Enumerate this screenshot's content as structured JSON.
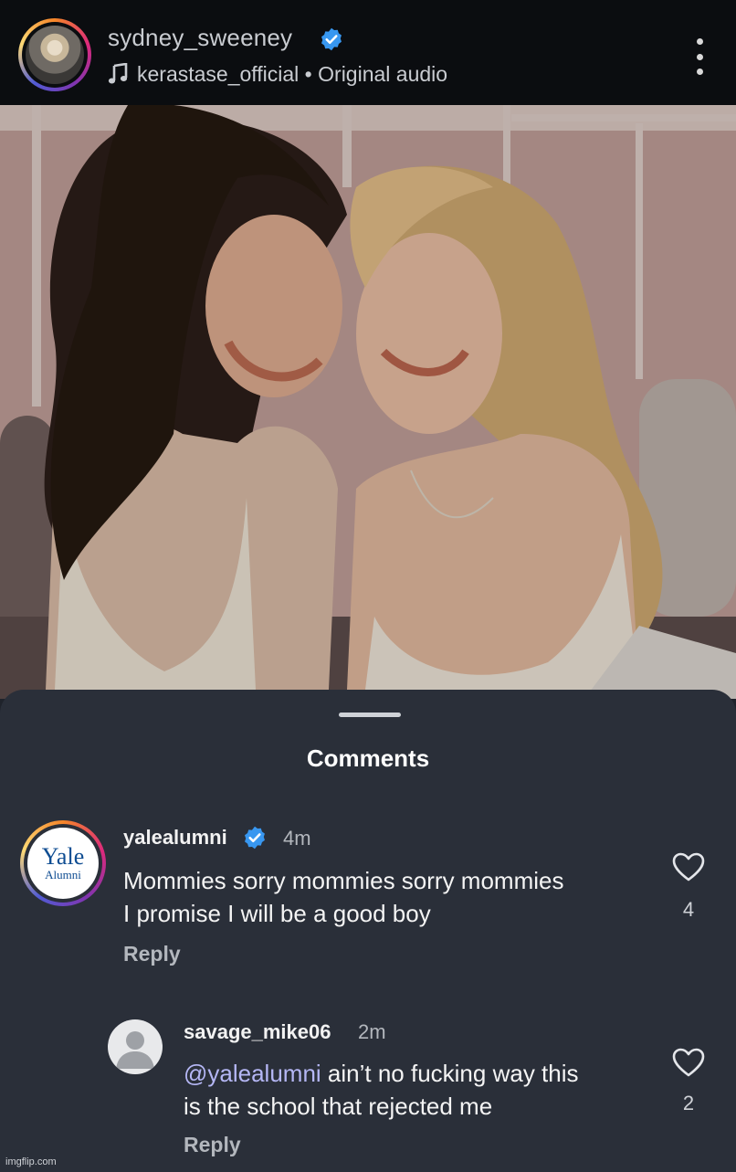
{
  "header": {
    "username": "sydney_sweeney",
    "audio_account": "kerastase_official",
    "audio_separator": " • ",
    "audio_label": "Original audio",
    "icons": [
      "verified-badge-icon",
      "music-note-icon",
      "more-options-icon"
    ]
  },
  "comments_sheet": {
    "title": "Comments",
    "comments": [
      {
        "username": "yalealumni",
        "verified": true,
        "time": "4m",
        "text_line1": "Mommies sorry mommies sorry mommies",
        "text_line2": "I promise I will be a good boy",
        "reply_label": "Reply",
        "likes": "4",
        "avatar_logo_word": "Yale",
        "avatar_logo_sub": "Alumni"
      },
      {
        "username": "savage_mike06",
        "verified": false,
        "time": "2m",
        "mention": "@yalealumni",
        "text_line1_rest": " ain’t no fucking way this",
        "text_line2": "is the school that rejected me",
        "reply_label": "Reply",
        "likes": "2"
      }
    ]
  },
  "watermark": "imgflip.com",
  "colors": {
    "header_bg": "#0b0d10",
    "sheet_bg": "#2a2f39",
    "verified_blue": "#3897f0",
    "mention": "#b5b7f5",
    "yale_blue": "#0f4d92"
  }
}
